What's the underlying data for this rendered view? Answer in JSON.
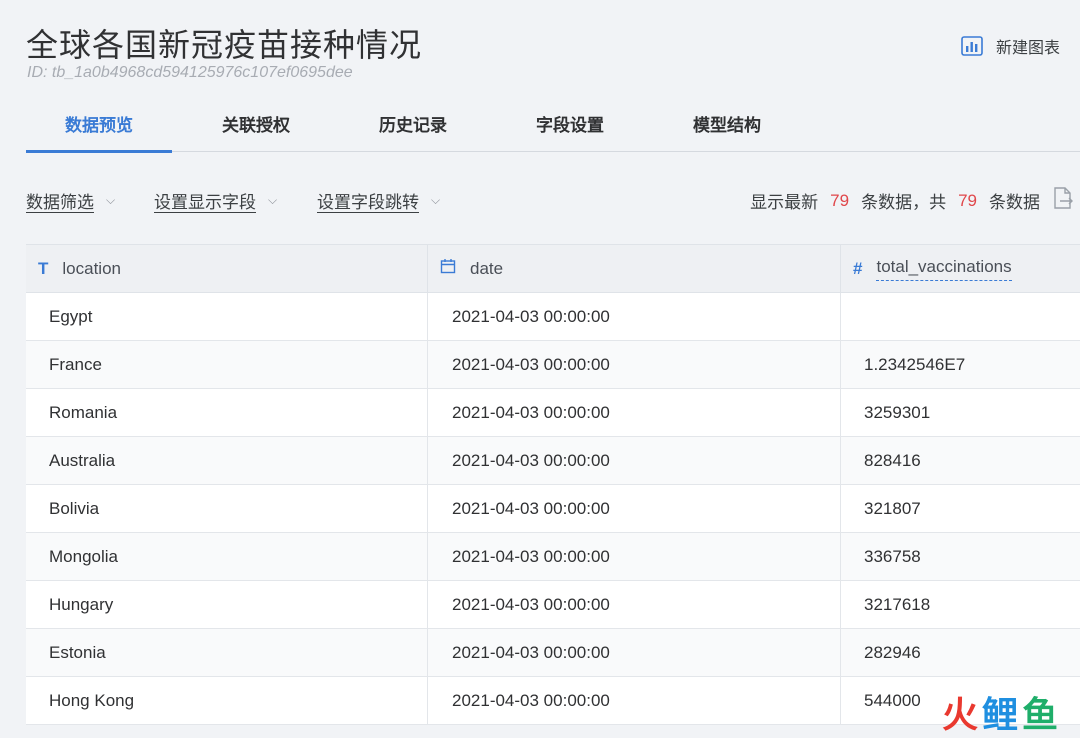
{
  "header": {
    "title": "全球各国新冠疫苗接种情况",
    "table_id": "ID: tb_1a0b4968cd594125976c107ef0695dee",
    "new_chart_label": "新建图表"
  },
  "tabs": [
    {
      "label": "数据预览",
      "active": true
    },
    {
      "label": "关联授权",
      "active": false
    },
    {
      "label": "历史记录",
      "active": false
    },
    {
      "label": "字段设置",
      "active": false
    },
    {
      "label": "模型结构",
      "active": false
    }
  ],
  "toolbar": {
    "filters": [
      "数据筛选",
      "设置显示字段",
      "设置字段跳转"
    ],
    "summary_prefix": "显示最新",
    "shown_count": "79",
    "summary_middle": "条数据，共",
    "total_count": "79",
    "summary_suffix": "条数据"
  },
  "table": {
    "columns": [
      {
        "name": "location",
        "type_icon": "T"
      },
      {
        "name": "date",
        "type_icon": "calendar-icon"
      },
      {
        "name": "total_vaccinations",
        "type_icon": "#"
      }
    ],
    "rows": [
      [
        "Egypt",
        "2021-04-03 00:00:00",
        ""
      ],
      [
        "France",
        "2021-04-03 00:00:00",
        "1.2342546E7"
      ],
      [
        "Romania",
        "2021-04-03 00:00:00",
        "3259301"
      ],
      [
        "Australia",
        "2021-04-03 00:00:00",
        "828416"
      ],
      [
        "Bolivia",
        "2021-04-03 00:00:00",
        "321807"
      ],
      [
        "Mongolia",
        "2021-04-03 00:00:00",
        "336758"
      ],
      [
        "Hungary",
        "2021-04-03 00:00:00",
        "3217618"
      ],
      [
        "Estonia",
        "2021-04-03 00:00:00",
        "282946"
      ],
      [
        "Hong Kong",
        "2021-04-03 00:00:00",
        "544000"
      ]
    ]
  },
  "watermark": [
    "火",
    "鲤",
    "鱼"
  ],
  "colors": {
    "accent": "#3a7bd5",
    "count": "#e0474b"
  }
}
